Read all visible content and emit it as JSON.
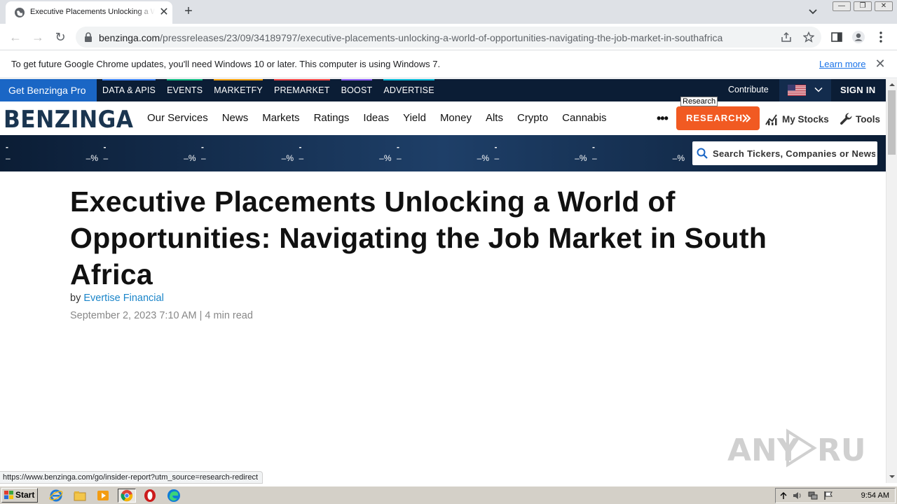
{
  "browser": {
    "tab_title": "Executive Placements Unlocking a World of Opportunities: Navigating the Job Market in South Africa",
    "tab_close": "✕",
    "new_tab": "+",
    "url_host": "benzinga.com",
    "url_path": "/pressreleases/23/09/34189797/executive-placements-unlocking-a-world-of-opportunities-navigating-the-job-market-in-southafrica",
    "back": "←",
    "forward": "→",
    "reload": "↻"
  },
  "infobar": {
    "message": "To get future Google Chrome updates, you'll need Windows 10 or later. This computer is using Windows 7.",
    "link": "Learn more",
    "close": "✕"
  },
  "topbar": {
    "pro_label": "Get Benzinga Pro",
    "links": [
      {
        "label": "DATA & APIS",
        "color": "#3b82f6"
      },
      {
        "label": "EVENTS",
        "color": "#10b981"
      },
      {
        "label": "MARKETFY",
        "color": "#f59e0b"
      },
      {
        "label": "PREMARKET",
        "color": "#ef4444"
      },
      {
        "label": "BOOST",
        "color": "#8b5cf6"
      },
      {
        "label": "ADVERTISE",
        "color": "#06b6d4"
      }
    ],
    "contribute": "Contribute",
    "signin": "SIGN IN"
  },
  "nav": {
    "logo": "BENZINGA",
    "items": [
      "Our Services",
      "News",
      "Markets",
      "Ratings",
      "Ideas",
      "Yield",
      "Money",
      "Alts",
      "Crypto",
      "Cannabis"
    ],
    "more": "•••",
    "research": "RESEARCH",
    "research_tooltip": "Research",
    "my_stocks": "My Stocks",
    "tools": "Tools"
  },
  "ticker": {
    "items": [
      {
        "sym": "-",
        "price": "–",
        "pct": "–%"
      },
      {
        "sym": "-",
        "price": "–",
        "pct": "–%"
      },
      {
        "sym": "-",
        "price": "–",
        "pct": "–%"
      },
      {
        "sym": "-",
        "price": "–",
        "pct": "–%"
      },
      {
        "sym": "-",
        "price": "–",
        "pct": "–%"
      },
      {
        "sym": "-",
        "price": "–",
        "pct": "–%"
      },
      {
        "sym": "-",
        "price": "–",
        "pct": "–%"
      }
    ],
    "search_placeholder": "Search Tickers, Companies or News..."
  },
  "article": {
    "title": "Executive Placements Unlocking a World of Opportunities: Navigating the Job Market in South Africa",
    "by": "by",
    "author": "Evertise Financial",
    "date": "September 2, 2023 7:10 AM",
    "separator": "|",
    "read_time": "4 min read"
  },
  "status_url": "https://www.benzinga.com/go/insider-report?utm_source=research-redirect",
  "taskbar": {
    "start": "Start",
    "clock": "9:54 AM"
  },
  "colors": {
    "navy": "#0b1d35",
    "pro_blue": "#1a66c5",
    "research_orange": "#f15a22",
    "author_link": "#1a85c9"
  }
}
